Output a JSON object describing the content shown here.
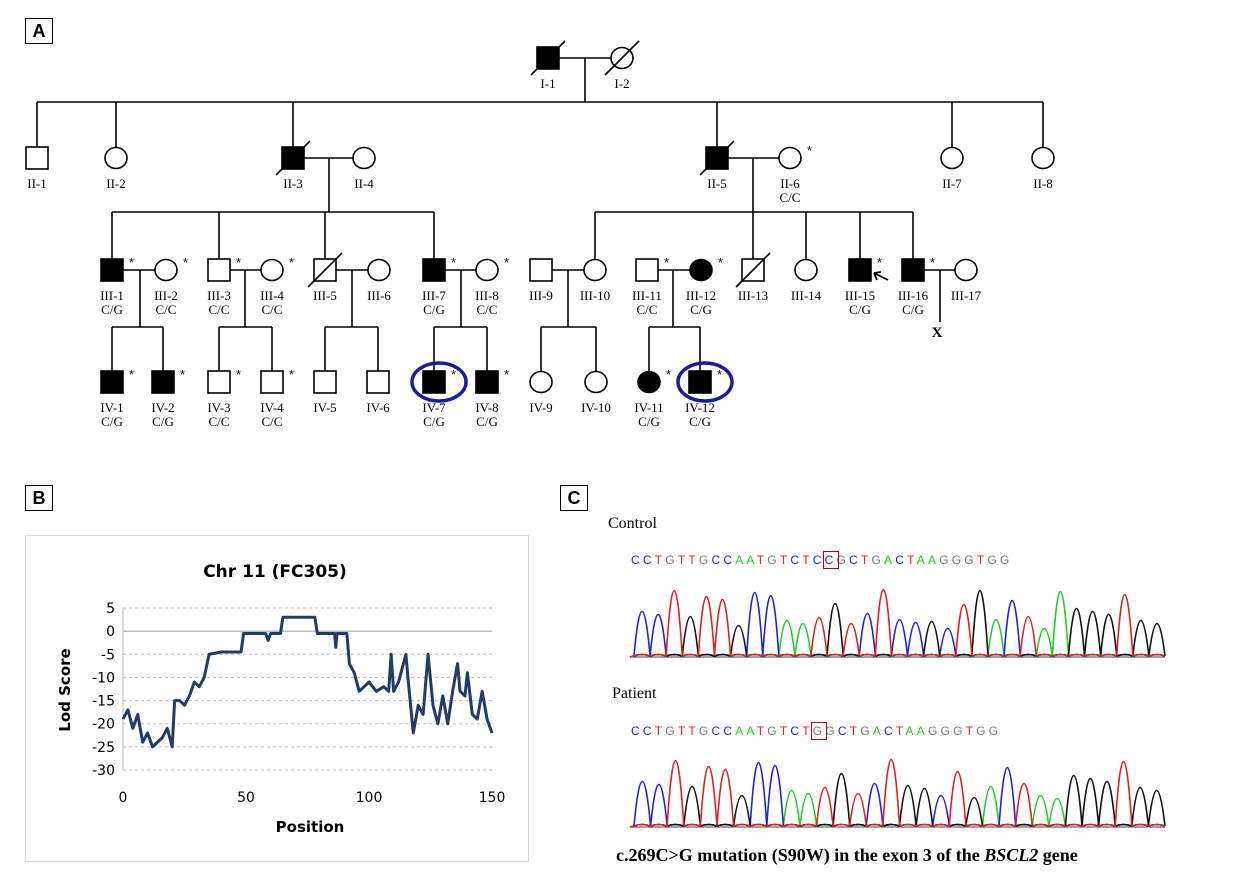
{
  "panels": {
    "a": "A",
    "b": "B",
    "c": "C"
  },
  "pedigree": {
    "individuals": [
      {
        "id": "I-1",
        "sex": "male",
        "affected": true,
        "deceased": true
      },
      {
        "id": "I-2",
        "sex": "female",
        "affected": false,
        "deceased": true
      },
      {
        "id": "II-1",
        "sex": "male",
        "affected": false
      },
      {
        "id": "II-2",
        "sex": "female",
        "affected": false
      },
      {
        "id": "II-3",
        "sex": "male",
        "affected": true,
        "deceased": true
      },
      {
        "id": "II-4",
        "sex": "female",
        "affected": false
      },
      {
        "id": "II-5",
        "sex": "male",
        "affected": true,
        "deceased": true
      },
      {
        "id": "II-6",
        "sex": "female",
        "affected": false,
        "tested": true,
        "genotype": "C/C"
      },
      {
        "id": "II-7",
        "sex": "female",
        "affected": false
      },
      {
        "id": "II-8",
        "sex": "female",
        "affected": false
      },
      {
        "id": "III-1",
        "sex": "male",
        "affected": true,
        "tested": true,
        "genotype": "C/G"
      },
      {
        "id": "III-2",
        "sex": "female",
        "affected": false,
        "tested": true,
        "genotype": "C/C"
      },
      {
        "id": "III-3",
        "sex": "male",
        "affected": false,
        "tested": true,
        "genotype": "C/C"
      },
      {
        "id": "III-4",
        "sex": "female",
        "affected": false,
        "tested": true,
        "genotype": "C/C"
      },
      {
        "id": "III-5",
        "sex": "male",
        "affected": false,
        "deceased": true
      },
      {
        "id": "III-6",
        "sex": "female",
        "affected": false
      },
      {
        "id": "III-7",
        "sex": "male",
        "affected": true,
        "tested": true,
        "genotype": "C/G"
      },
      {
        "id": "III-8",
        "sex": "female",
        "affected": false,
        "tested": true,
        "genotype": "C/C"
      },
      {
        "id": "III-9",
        "sex": "male",
        "affected": false
      },
      {
        "id": "III-10",
        "sex": "female",
        "affected": false
      },
      {
        "id": "III-11",
        "sex": "male",
        "affected": false,
        "tested": true,
        "genotype": "C/C"
      },
      {
        "id": "III-12",
        "sex": "female",
        "affected": true,
        "tested": true,
        "genotype": "C/G"
      },
      {
        "id": "III-13",
        "sex": "male",
        "affected": false,
        "deceased": true
      },
      {
        "id": "III-14",
        "sex": "female",
        "affected": false
      },
      {
        "id": "III-15",
        "sex": "male",
        "affected": true,
        "tested": true,
        "genotype": "C/G",
        "proband": true
      },
      {
        "id": "III-16",
        "sex": "male",
        "affected": true,
        "tested": true,
        "genotype": "C/G"
      },
      {
        "id": "III-17",
        "sex": "female",
        "affected": false
      },
      {
        "id": "IV-1",
        "sex": "male",
        "affected": true,
        "tested": true,
        "genotype": "C/G"
      },
      {
        "id": "IV-2",
        "sex": "male",
        "affected": true,
        "tested": true,
        "genotype": "C/G"
      },
      {
        "id": "IV-3",
        "sex": "male",
        "affected": false,
        "tested": true,
        "genotype": "C/C"
      },
      {
        "id": "IV-4",
        "sex": "male",
        "affected": false,
        "tested": true,
        "genotype": "C/C"
      },
      {
        "id": "IV-5",
        "sex": "male",
        "affected": false
      },
      {
        "id": "IV-6",
        "sex": "male",
        "affected": false
      },
      {
        "id": "IV-7",
        "sex": "male",
        "affected": true,
        "tested": true,
        "genotype": "C/G",
        "circled": true
      },
      {
        "id": "IV-8",
        "sex": "male",
        "affected": true,
        "tested": true,
        "genotype": "C/G"
      },
      {
        "id": "IV-9",
        "sex": "female",
        "affected": false
      },
      {
        "id": "IV-10",
        "sex": "female",
        "affected": false
      },
      {
        "id": "IV-11",
        "sex": "female",
        "affected": true,
        "tested": true,
        "genotype": "C/G"
      },
      {
        "id": "IV-12",
        "sex": "male",
        "affected": true,
        "tested": true,
        "genotype": "C/G",
        "circled": true
      }
    ],
    "no_offspring_mark": "X",
    "tested_mark": "*",
    "highlight_color": "#1a1aa6"
  },
  "chart_data": {
    "type": "line",
    "title": "Chr 11 (FC305)",
    "xlabel": "Position",
    "ylabel": "Lod Score",
    "xlim": [
      0,
      150
    ],
    "ylim": [
      -30,
      5
    ],
    "xticks": [
      0,
      50,
      100,
      150
    ],
    "yticks": [
      5,
      0,
      -5,
      -10,
      -15,
      -20,
      -25,
      -30
    ],
    "grid": "horizontal dashed",
    "line_color": "#1f3d66",
    "series": [
      {
        "x": [
          0,
          2,
          4,
          6,
          8,
          10,
          12,
          14,
          16,
          18,
          20,
          21,
          23,
          25,
          27,
          29,
          31,
          33,
          35,
          40,
          48,
          49,
          58,
          59,
          60,
          64,
          65,
          78,
          79,
          86,
          86.5,
          87,
          91,
          92,
          94,
          96,
          98,
          100,
          103,
          106,
          108,
          109,
          110,
          112,
          115,
          116,
          118,
          120,
          122,
          124,
          126,
          128,
          130,
          132,
          134,
          136,
          137,
          139,
          140,
          142,
          144,
          146,
          148,
          150
        ],
        "y": [
          -19,
          -17,
          -21,
          -18,
          -24,
          -22,
          -25,
          -24,
          -23,
          -21,
          -25,
          -15,
          -15,
          -16,
          -14,
          -11,
          -12,
          -10,
          -5,
          -4.5,
          -4.5,
          -0.5,
          -0.5,
          -2,
          -0.5,
          -0.5,
          3,
          3,
          -0.5,
          -0.5,
          -3.5,
          -0.5,
          -0.5,
          -7,
          -9,
          -13,
          -12,
          -11,
          -13,
          -12,
          -13,
          -5,
          -13,
          -11,
          -5,
          -11,
          -22,
          -16,
          -18,
          -5,
          -16,
          -20,
          -14,
          -20,
          -13,
          -7,
          -13,
          -14,
          -9,
          -18,
          -19,
          -13,
          -19,
          -22
        ]
      }
    ]
  },
  "sequencing": {
    "control": {
      "label": "Control",
      "prefix": "CCTGTTGCCAATGTCTC",
      "boxed": "C",
      "suffix": "GCTGACTAAGGGTGG"
    },
    "patient": {
      "label": "Patient",
      "prefix": "CCTGTTGCCAATGTCT",
      "boxed": "G",
      "suffix": "GCTGACTAAGGGTGG"
    },
    "base_colors": {
      "A": "#22cc22",
      "C": "#2222dd",
      "G": "#111111",
      "T": "#dd2222"
    },
    "caption_pre": "c.269C>G mutation (S90W) in the exon 3 of the ",
    "caption_gene": "BSCL2",
    "caption_post": " gene"
  }
}
